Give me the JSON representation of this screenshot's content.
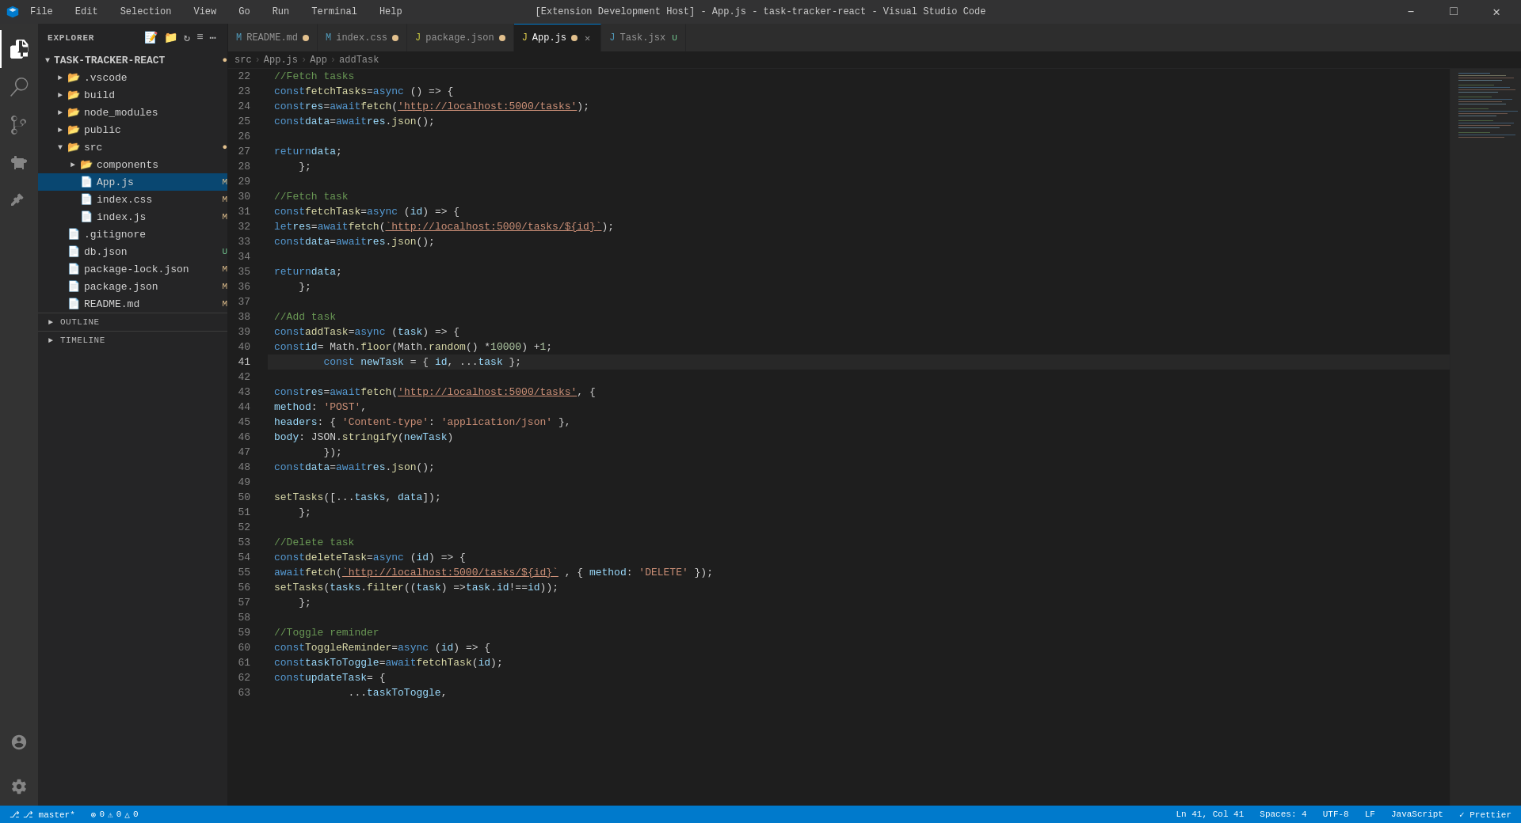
{
  "titleBar": {
    "title": "[Extension Development Host] - App.js - task-tracker-react - Visual Studio Code",
    "menu": [
      "File",
      "Edit",
      "Selection",
      "View",
      "Go",
      "Run",
      "Terminal",
      "Help"
    ],
    "controls": [
      "minimize",
      "maximize",
      "close"
    ]
  },
  "activityBar": {
    "items": [
      {
        "name": "explorer",
        "icon": "⎘",
        "active": true
      },
      {
        "name": "search",
        "icon": "🔍"
      },
      {
        "name": "source-control",
        "icon": "⎇"
      },
      {
        "name": "debug",
        "icon": "▷"
      },
      {
        "name": "extensions",
        "icon": "⊞"
      }
    ],
    "bottom": [
      {
        "name": "account",
        "icon": "👤"
      },
      {
        "name": "settings",
        "icon": "⚙"
      }
    ]
  },
  "sidebar": {
    "title": "EXPLORER",
    "root": "TASK-TRACKER-REACT",
    "items": [
      {
        "indent": 0,
        "type": "folder",
        "label": ".vscode",
        "badge": "",
        "badgeType": ""
      },
      {
        "indent": 0,
        "type": "folder",
        "label": "build",
        "badge": "",
        "badgeType": ""
      },
      {
        "indent": 0,
        "type": "folder",
        "label": "node_modules",
        "badge": "",
        "badgeType": ""
      },
      {
        "indent": 0,
        "type": "folder",
        "label": "public",
        "badge": "",
        "badgeType": ""
      },
      {
        "indent": 0,
        "type": "folder",
        "label": "src",
        "open": true,
        "badge": "",
        "badgeType": ""
      },
      {
        "indent": 1,
        "type": "folder",
        "label": "components",
        "badge": "",
        "badgeType": ""
      },
      {
        "indent": 1,
        "type": "file",
        "label": "App.js",
        "fileType": "js",
        "active": true,
        "badge": "M",
        "badgeType": "modified"
      },
      {
        "indent": 1,
        "type": "file",
        "label": "index.css",
        "fileType": "css",
        "badge": "M",
        "badgeType": "modified"
      },
      {
        "indent": 1,
        "type": "file",
        "label": "index.js",
        "fileType": "js",
        "badge": "M",
        "badgeType": "modified"
      },
      {
        "indent": 0,
        "type": "file",
        "label": ".gitignore",
        "fileType": "git",
        "badge": "",
        "badgeType": ""
      },
      {
        "indent": 0,
        "type": "file",
        "label": "db.json",
        "fileType": "json",
        "badge": "U",
        "badgeType": "untracked"
      },
      {
        "indent": 0,
        "type": "file",
        "label": "package-lock.json",
        "fileType": "json",
        "badge": "M",
        "badgeType": "modified"
      },
      {
        "indent": 0,
        "type": "file",
        "label": "package.json",
        "fileType": "json",
        "badge": "M",
        "badgeType": "modified"
      },
      {
        "indent": 0,
        "type": "file",
        "label": "README.md",
        "fileType": "md",
        "badge": "M",
        "badgeType": "modified"
      }
    ],
    "sections": [
      "OUTLINE",
      "TIMELINE"
    ]
  },
  "tabs": [
    {
      "label": "README.md",
      "badge": "M",
      "icon": "md",
      "active": false,
      "closable": false
    },
    {
      "label": "index.css",
      "badge": "M",
      "icon": "css",
      "active": false,
      "closable": false
    },
    {
      "label": "package.json",
      "badge": "M",
      "icon": "json",
      "active": false,
      "closable": false
    },
    {
      "label": "App.js",
      "badge": "M",
      "icon": "js",
      "active": true,
      "closable": true
    },
    {
      "label": "Task.jsx",
      "badge": "U",
      "icon": "jsx",
      "active": false,
      "closable": false
    }
  ],
  "breadcrumb": {
    "parts": [
      "src",
      "App.js",
      "App",
      "addTask"
    ]
  },
  "code": {
    "lines": [
      {
        "num": 22,
        "content": "    <span class='cmt'>//Fetch tasks</span>"
      },
      {
        "num": 23,
        "content": "    <span class='kw'>const</span> <span class='fn'>fetchTasks</span> <span class='op'>=</span> <span class='kw'>async</span> () <span class='op'>=></span> {"
      },
      {
        "num": 24,
        "content": "        <span class='kw'>const</span> <span class='var'>res</span> <span class='op'>=</span> <span class='kw'>await</span> <span class='fn'>fetch</span>(<span class='str-link'>'http://localhost:5000/tasks'</span>);"
      },
      {
        "num": 25,
        "content": "        <span class='kw'>const</span> <span class='var'>data</span> <span class='op'>=</span> <span class='kw'>await</span> <span class='var'>res</span>.<span class='fn'>json</span>();"
      },
      {
        "num": 26,
        "content": ""
      },
      {
        "num": 27,
        "content": "        <span class='kw'>return</span> <span class='var'>data</span>;"
      },
      {
        "num": 28,
        "content": "    };"
      },
      {
        "num": 29,
        "content": ""
      },
      {
        "num": 30,
        "content": "    <span class='cmt'>//Fetch task</span>"
      },
      {
        "num": 31,
        "content": "    <span class='kw'>const</span> <span class='fn'>fetchTask</span> <span class='op'>=</span> <span class='kw'>async</span> (<span class='var'>id</span>) <span class='op'>=></span> {"
      },
      {
        "num": 32,
        "content": "        <span class='kw'>let</span> <span class='var'>res</span> <span class='op'>=</span> <span class='kw'>await</span> <span class='fn'>fetch</span>(<span class='str-link'>`http://localhost:5000/tasks/${id}`</span>);"
      },
      {
        "num": 33,
        "content": "        <span class='kw'>const</span> <span class='var'>data</span> <span class='op'>=</span> <span class='kw'>await</span> <span class='var'>res</span>.<span class='fn'>json</span>();"
      },
      {
        "num": 34,
        "content": ""
      },
      {
        "num": 35,
        "content": "        <span class='kw'>return</span> <span class='var'>data</span>;"
      },
      {
        "num": 36,
        "content": "    };"
      },
      {
        "num": 37,
        "content": ""
      },
      {
        "num": 38,
        "content": "    <span class='cmt'>//Add task</span>"
      },
      {
        "num": 39,
        "content": "    <span class='kw'>const</span> <span class='fn'>addTask</span> <span class='op'>=</span> <span class='kw'>async</span> (<span class='var'>task</span>) <span class='op'>=></span> {"
      },
      {
        "num": 40,
        "content": "        <span class='kw'>const</span> <span class='var'>id</span> <span class='op'>=</span> Math.<span class='fn'>floor</span>(Math.<span class='fn'>random</span>() <span class='op'>*</span> <span class='num'>10000</span>) <span class='op'>+</span> <span class='num'>1</span>;"
      },
      {
        "num": 41,
        "content": "        <span class='kw'>const</span> <span class='var'>newTask</span> <span class='op'>=</span> { <span class='var'>id</span>, ...<span class='var'>task</span> };",
        "current": true
      },
      {
        "num": 42,
        "content": ""
      },
      {
        "num": 43,
        "content": "        <span class='kw'>const</span> <span class='var'>res</span> <span class='op'>=</span> <span class='kw'>await</span> <span class='fn'>fetch</span>(<span class='str-link'>'http://localhost:5000/tasks'</span>, {"
      },
      {
        "num": 44,
        "content": "            <span class='prop'>method</span>: <span class='str'>'POST'</span>,"
      },
      {
        "num": 45,
        "content": "            <span class='prop'>headers</span>: { <span class='str'>'Content-type'</span>: <span class='str'>'application/json'</span> },"
      },
      {
        "num": 46,
        "content": "            <span class='prop'>body</span>: JSON.<span class='fn'>stringify</span>(<span class='var'>newTask</span>)"
      },
      {
        "num": 47,
        "content": "        });"
      },
      {
        "num": 48,
        "content": "        <span class='kw'>const</span> <span class='var'>data</span> <span class='op'>=</span> <span class='kw'>await</span> <span class='var'>res</span>.<span class='fn'>json</span>();"
      },
      {
        "num": 49,
        "content": ""
      },
      {
        "num": 50,
        "content": "        <span class='fn'>setTasks</span>([...<span class='var'>tasks</span>, <span class='var'>data</span>]);"
      },
      {
        "num": 51,
        "content": "    };"
      },
      {
        "num": 52,
        "content": ""
      },
      {
        "num": 53,
        "content": "    <span class='cmt'>//Delete task</span>"
      },
      {
        "num": 54,
        "content": "    <span class='kw'>const</span> <span class='fn'>deleteTask</span> <span class='op'>=</span> <span class='kw'>async</span> (<span class='var'>id</span>) <span class='op'>=></span> {"
      },
      {
        "num": 55,
        "content": "        <span class='kw'>await</span> <span class='fn'>fetch</span>(<span class='str-link'>`http://localhost:5000/tasks/${id}`</span> , { <span class='prop'>method</span>: <span class='str'>'DELETE'</span> });"
      },
      {
        "num": 56,
        "content": "        <span class='fn'>setTasks</span>(<span class='var'>tasks</span>.<span class='fn'>filter</span>((<span class='var'>task</span>) <span class='op'>=></span> <span class='var'>task</span>.<span class='prop'>id</span> <span class='op'>!==</span> <span class='var'>id</span>));"
      },
      {
        "num": 57,
        "content": "    };"
      },
      {
        "num": 58,
        "content": ""
      },
      {
        "num": 59,
        "content": "    <span class='cmt'>//Toggle reminder</span>"
      },
      {
        "num": 60,
        "content": "    <span class='kw'>const</span> <span class='fn'>ToggleReminder</span> <span class='op'>=</span> <span class='kw'>async</span> (<span class='var'>id</span>) <span class='op'>=></span> {"
      },
      {
        "num": 61,
        "content": "        <span class='kw'>const</span> <span class='var'>taskToToggle</span> <span class='op'>=</span> <span class='kw'>await</span> <span class='fn'>fetchTask</span>(<span class='var'>id</span>);"
      },
      {
        "num": 62,
        "content": "        <span class='kw'>const</span> <span class='var'>updateTask</span> <span class='op'>=</span> {"
      },
      {
        "num": 63,
        "content": "            ...<span class='var'>taskToToggle</span>,"
      }
    ]
  },
  "statusBar": {
    "left": [
      {
        "label": "⎇ master*",
        "name": "git-branch"
      },
      {
        "label": "⊗ 0",
        "name": "errors"
      },
      {
        "label": "⚠ 0 △ 0",
        "name": "warnings"
      }
    ],
    "right": [
      {
        "label": "Ln 41, Col 41",
        "name": "cursor-position"
      },
      {
        "label": "Spaces: 4",
        "name": "indentation"
      },
      {
        "label": "UTF-8",
        "name": "encoding"
      },
      {
        "label": "LF",
        "name": "line-ending"
      },
      {
        "label": "JavaScript",
        "name": "language-mode"
      },
      {
        "label": "✓ Prettier",
        "name": "prettier"
      }
    ]
  }
}
